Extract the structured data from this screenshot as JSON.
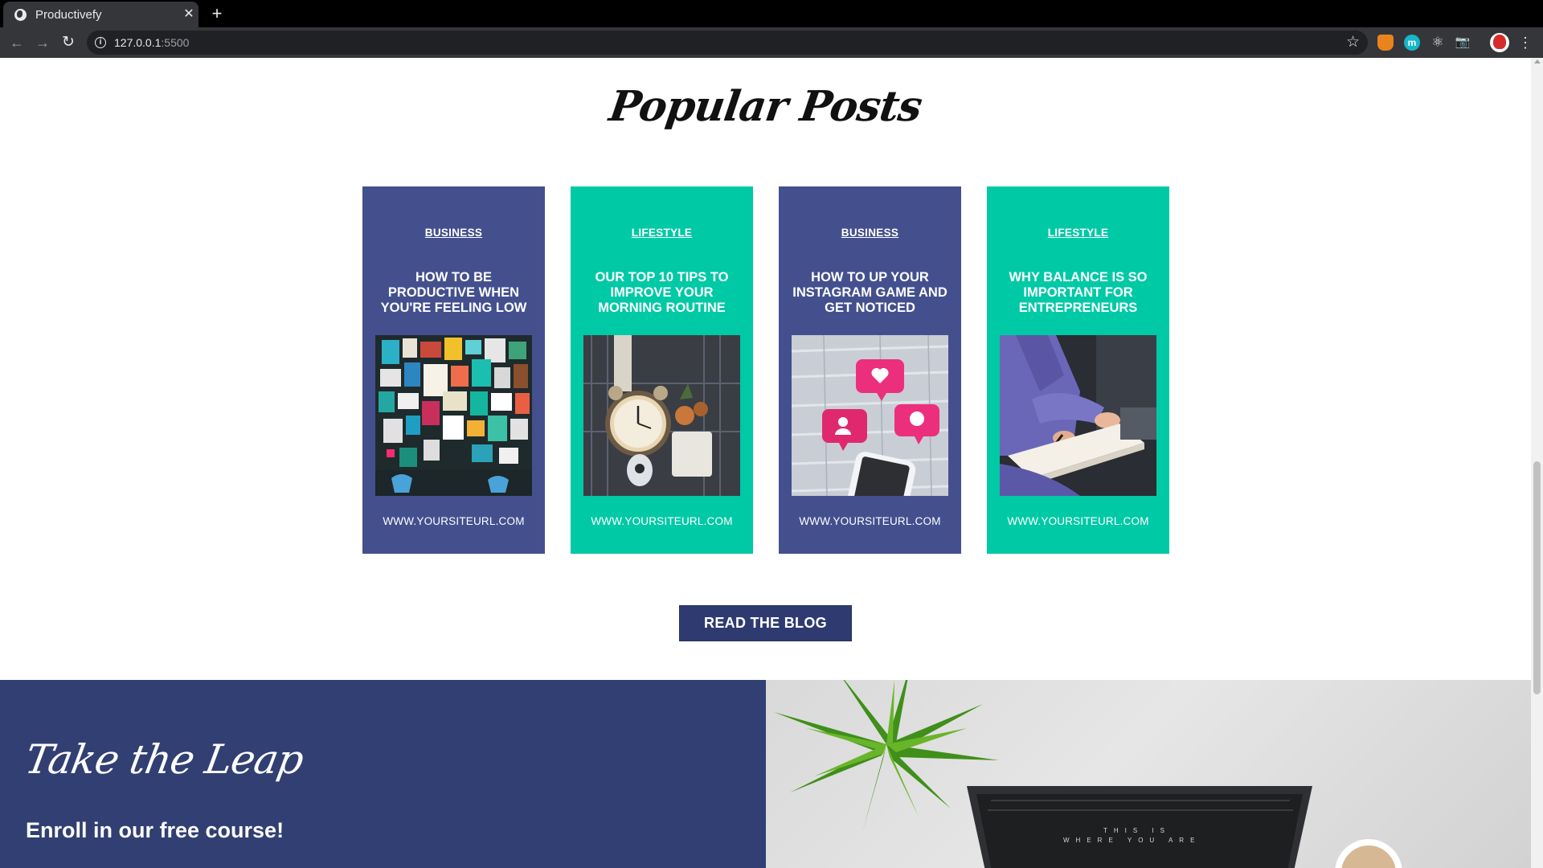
{
  "browser": {
    "tab_title": "Productivefy",
    "tab_close": "✕",
    "new_tab": "+",
    "url_host": "127.0.0.1",
    "url_port": ":5500"
  },
  "popular": {
    "title": "Popular Posts",
    "cards": [
      {
        "category": "BUSINESS",
        "title": "HOW TO BE PRODUCTIVE WHEN YOU'RE FEELING LOW",
        "url": "WWW.YOURSITEURL.COM",
        "color": "#44508e"
      },
      {
        "category": "LIFESTYLE",
        "title": "OUR TOP 10 TIPS TO IMPROVE YOUR MORNING ROUTINE",
        "url": "WWW.YOURSITEURL.COM",
        "color": "#00c9a6"
      },
      {
        "category": "BUSINESS",
        "title": "HOW TO UP YOUR INSTAGRAM GAME AND GET NOTICED",
        "url": "WWW.YOURSITEURL.COM",
        "color": "#44508e"
      },
      {
        "category": "LIFESTYLE",
        "title": "WHY BALANCE IS SO IMPORTANT FOR ENTREPRENEURS",
        "url": "WWW.YOURSITEURL.COM",
        "color": "#00c9a6"
      }
    ],
    "cta_label": "READ THE BLOG"
  },
  "leap": {
    "title": "Take the Leap",
    "subtitle": "Enroll in our free course!"
  }
}
